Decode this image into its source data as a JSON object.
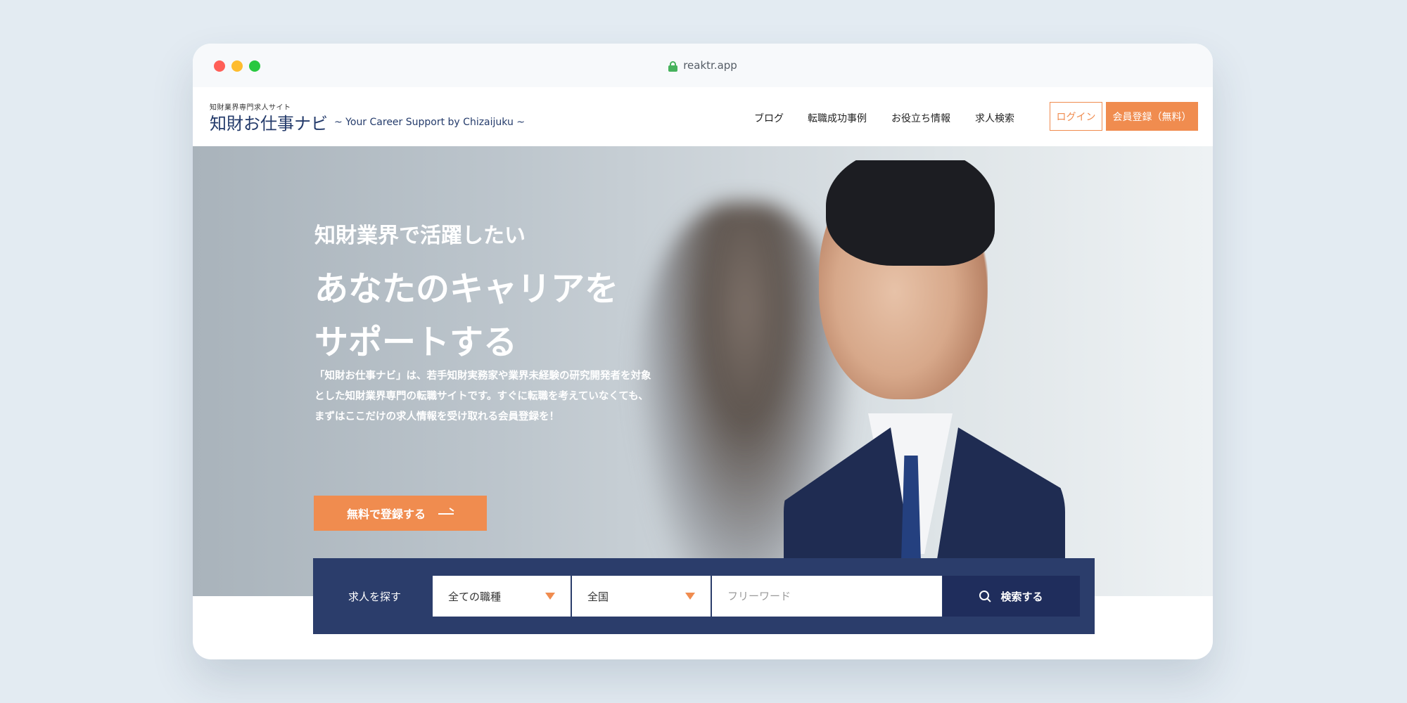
{
  "browser": {
    "url": "reaktr.app"
  },
  "header": {
    "tagline_small": "知財業界専門求人サイト",
    "logo": "知財お仕事ナビ",
    "logo_sub": "~ Your Career Support by Chizaijuku ~",
    "nav": [
      "ブログ",
      "転職成功事例",
      "お役立ち情報",
      "求人検索"
    ],
    "login_label": "ログイン",
    "register_label": "会員登録（無料）"
  },
  "hero": {
    "lead": "知財業界で活躍したい",
    "title_line1": "あなたのキャリアを",
    "title_line2": "サポートする",
    "desc_line1": "「知財お仕事ナビ」は、若手知財実務家や業界未経験の研究開発者を対象",
    "desc_line2": "とした知財業界専門の転職サイトです。すぐに転職を考えていなくても、",
    "desc_line3": "まずはここだけの求人情報を受け取れる会員登録を！",
    "cta_label": "無料で登録する"
  },
  "search": {
    "label": "求人を探す",
    "job_type": "全ての職種",
    "region": "全国",
    "keyword_placeholder": "フリーワード",
    "button_label": "検索する"
  },
  "colors": {
    "accent": "#f08c4f",
    "navy": "#2b3d6b",
    "navy_dark": "#1f2d5c",
    "logo": "#243b6b"
  },
  "icons": [
    "lock-icon",
    "arrow-right-icon",
    "chevron-down-icon",
    "search-icon"
  ]
}
